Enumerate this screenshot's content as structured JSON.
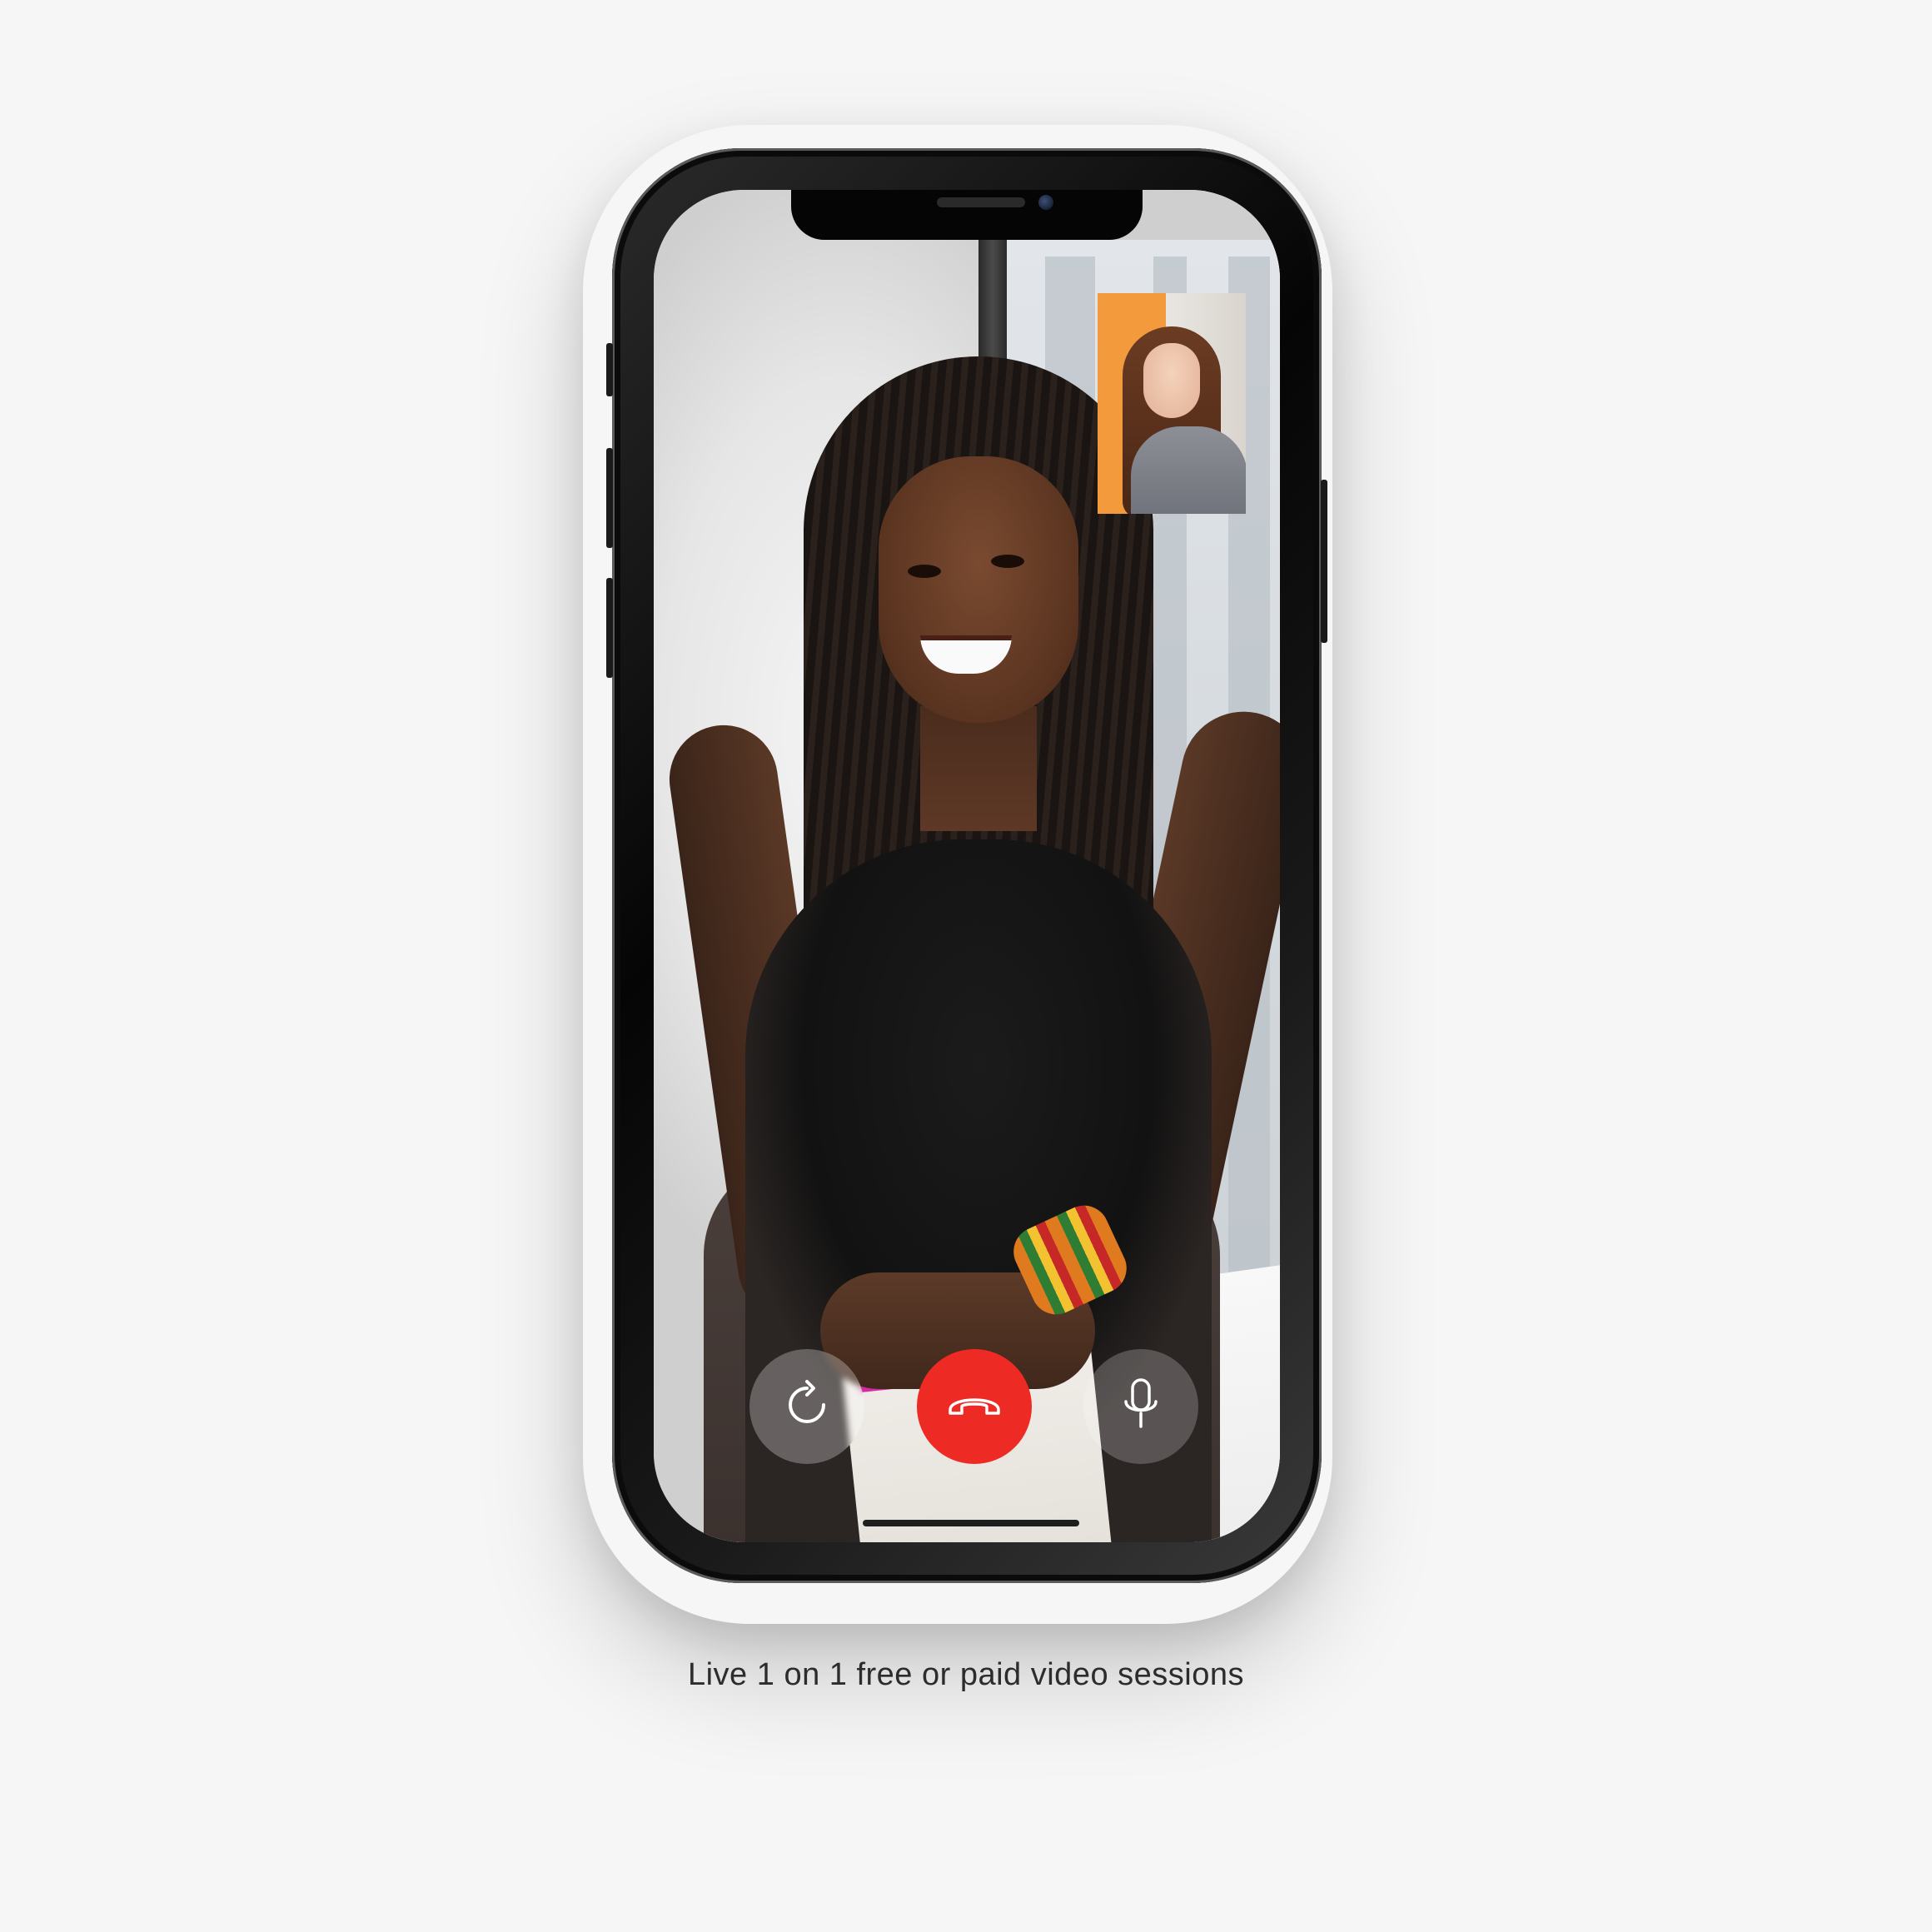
{
  "caption": {
    "text": "Live 1 on 1 free or paid video sessions"
  },
  "call": {
    "controls": [
      {
        "name": "flip-camera",
        "icon": "rotate-icon"
      },
      {
        "name": "end-call",
        "icon": "phone-hangup-icon",
        "color": "#ee2a24"
      },
      {
        "name": "microphone",
        "icon": "microphone-icon"
      }
    ]
  },
  "colors": {
    "background": "#f6f6f6",
    "end_call": "#ee2a24",
    "caption_text": "#2c2c2c"
  }
}
